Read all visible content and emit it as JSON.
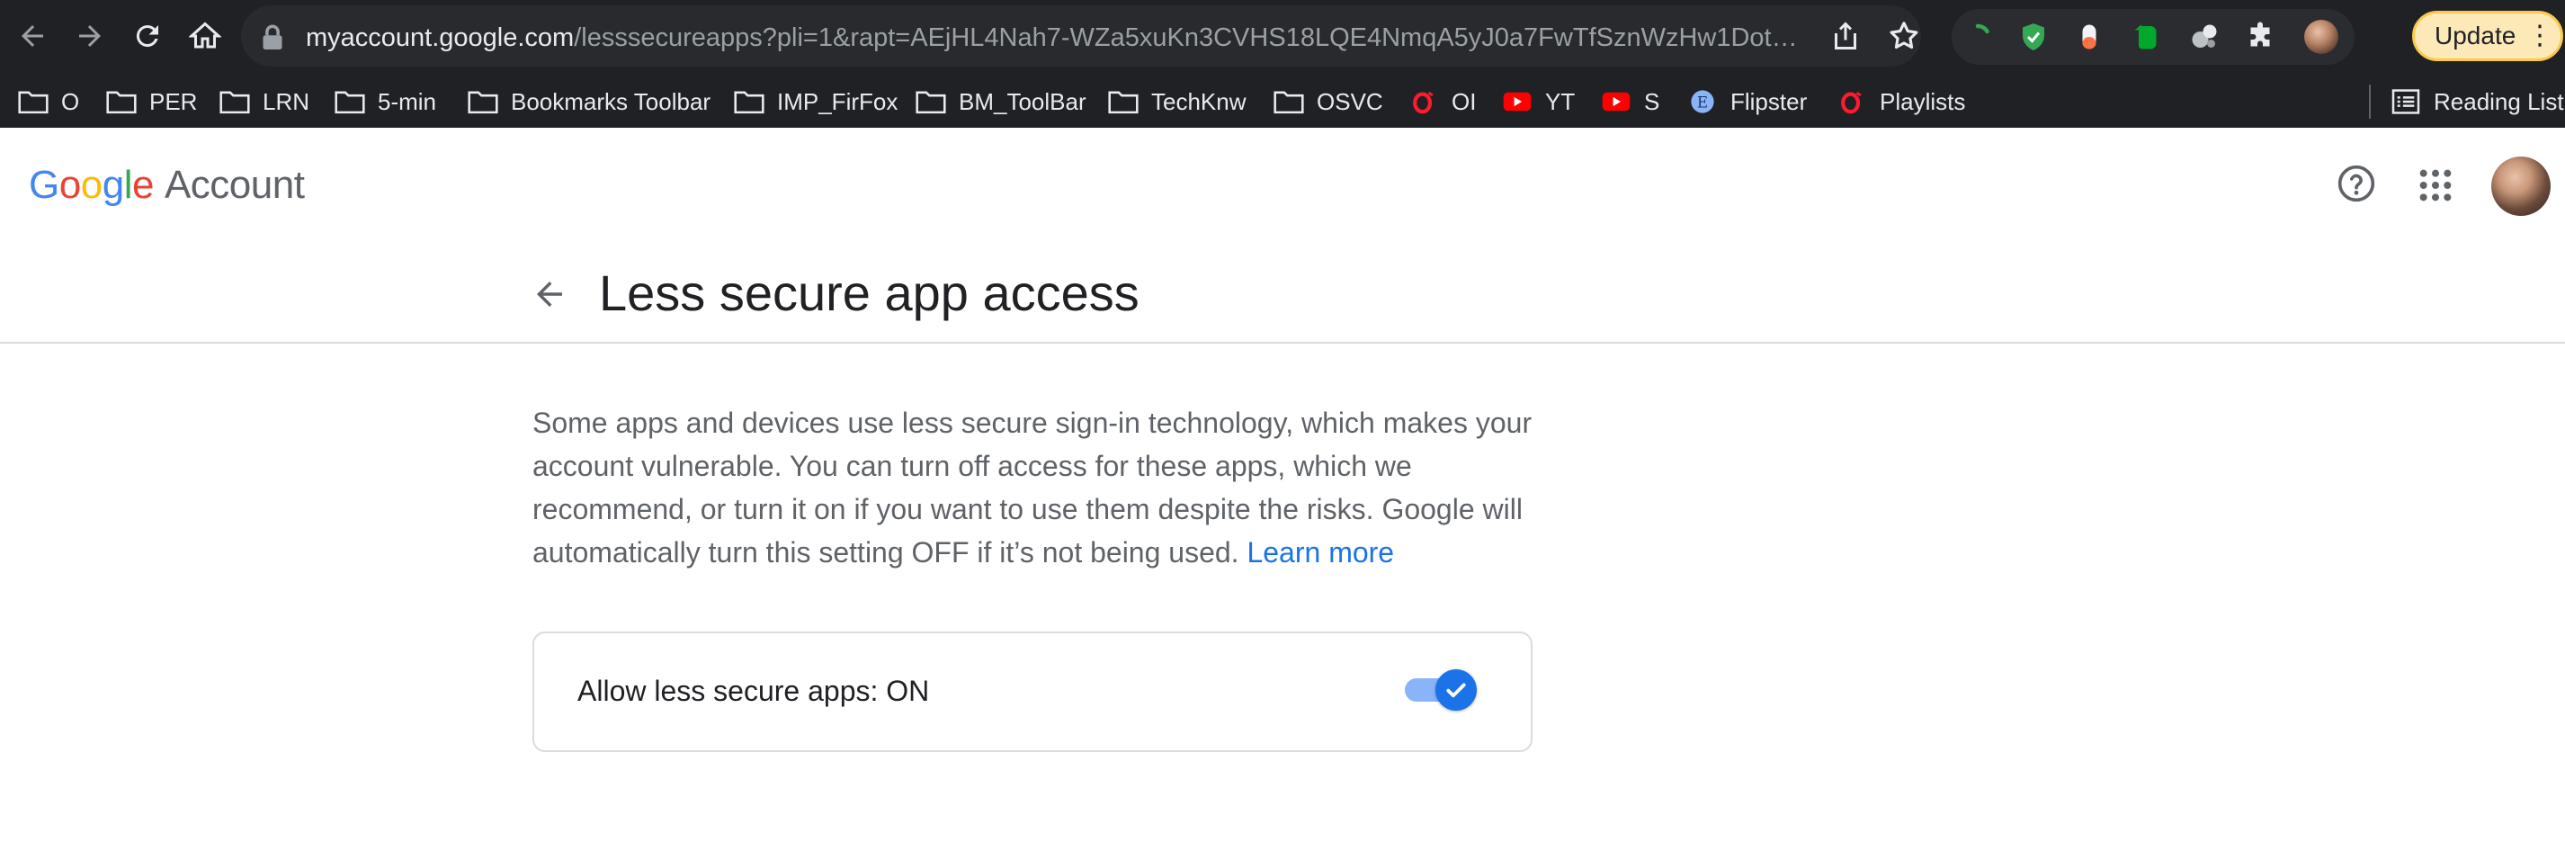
{
  "colors": {
    "accent": "#1a73e8",
    "chrome_bg": "#202124",
    "update_border": "#fbc94b"
  },
  "browser": {
    "url_host": "myaccount.google.com",
    "url_rest": "/lesssecureapps?pli=1&rapt=AEjHL4Nah7-WZa5xuKn3CVHS18LQE4NmqA5yJ0a7FwTfSznWzHw1Dot…",
    "update_label": "Update",
    "extensions": [
      "loading-icon",
      "shield-check-icon",
      "pill-icon",
      "evernote-icon",
      "multi-ball-icon",
      "puzzle-icon",
      "profile-avatar-icon"
    ]
  },
  "bookmarks": {
    "items": [
      {
        "label": "O",
        "icon": "folder-icon"
      },
      {
        "label": "PER",
        "icon": "folder-icon"
      },
      {
        "label": "LRN",
        "icon": "folder-icon"
      },
      {
        "label": "5-min",
        "icon": "folder-icon"
      },
      {
        "label": "Bookmarks Toolbar",
        "icon": "folder-icon"
      },
      {
        "label": "IMP_FirFox",
        "icon": "folder-icon"
      },
      {
        "label": "BM_ToolBar",
        "icon": "folder-icon"
      },
      {
        "label": "TechKnw",
        "icon": "folder-icon"
      },
      {
        "label": "OSVC",
        "icon": "folder-icon"
      },
      {
        "label": "OI",
        "icon": "opera-icon"
      },
      {
        "label": "YT",
        "icon": "youtube-icon"
      },
      {
        "label": "S",
        "icon": "youtube-icon"
      },
      {
        "label": "Flipster",
        "icon": "flipster-icon"
      },
      {
        "label": "Playlists",
        "icon": "opera-icon"
      }
    ],
    "reading_list": "Reading List"
  },
  "header": {
    "logo_g1": "G",
    "logo_o1": "o",
    "logo_o2": "o",
    "logo_g2": "g",
    "logo_l": "l",
    "logo_e": "e",
    "product": "Account"
  },
  "page": {
    "title": "Less secure app access",
    "description": "Some apps and devices use less secure sign-in technology, which makes your account vulnerable. You can turn off access for these apps, which we recommend, or turn it on if you want to use them despite the risks. Google will automatically turn this setting OFF if it’s not being used.",
    "learn_more": "Learn more"
  },
  "setting": {
    "label": "Allow less secure apps: ON",
    "enabled": true
  }
}
